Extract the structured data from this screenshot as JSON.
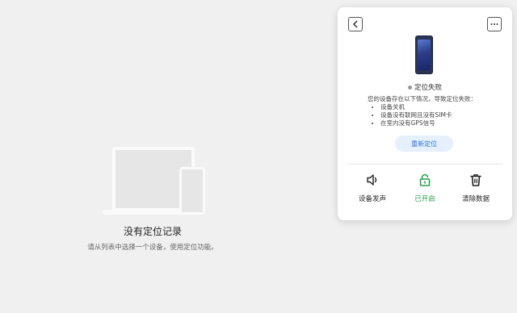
{
  "empty_state": {
    "title": "没有定位记录",
    "description": "请从列表中选择一个设备，使用定位功能。"
  },
  "panel": {
    "status": "定位失败",
    "reason_intro": "您的设备存在以下情况，导致定位失败：",
    "reasons": [
      "设备关机",
      "设备没有联网且没有SIM卡",
      "在室内没有GPS信号"
    ],
    "relocate_label": "重新定位",
    "actions": [
      {
        "label": "设备发声",
        "icon": "speaker-icon"
      },
      {
        "label": "已开启",
        "icon": "lock-icon",
        "color": "#2aa04a"
      },
      {
        "label": "清除数据",
        "icon": "trash-icon"
      }
    ]
  }
}
